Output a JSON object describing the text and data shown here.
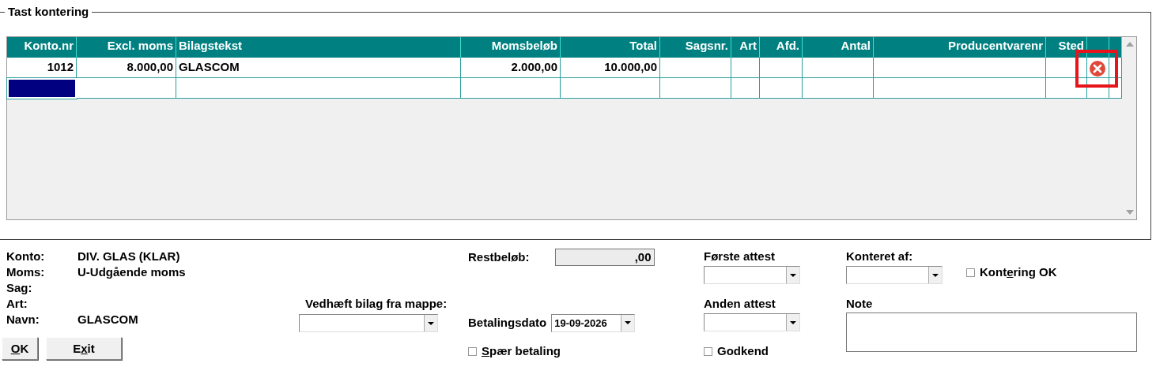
{
  "group": {
    "title": "Tast kontering"
  },
  "table": {
    "columns": [
      {
        "label": "Konto.nr",
        "kind": "number"
      },
      {
        "label": "Excl. moms",
        "kind": "number"
      },
      {
        "label": "Bilagstekst",
        "kind": "text"
      },
      {
        "label": "Momsbeløb",
        "kind": "number"
      },
      {
        "label": "Total",
        "kind": "number"
      },
      {
        "label": "Sagsnr.",
        "kind": "number"
      },
      {
        "label": "Art",
        "kind": "number"
      },
      {
        "label": "Afd.",
        "kind": "number"
      },
      {
        "label": "Antal",
        "kind": "number"
      },
      {
        "label": "Producentvarenr",
        "kind": "number"
      },
      {
        "label": "Sted",
        "kind": "number"
      },
      {
        "kind": "blank"
      },
      {
        "kind": "blank"
      }
    ],
    "rows": [
      {
        "cells": [
          "1012",
          "8.000,00",
          "GLASCOM",
          "2.000,00",
          "10.000,00"
        ],
        "selected": false,
        "deletable": true,
        "highlighted": true
      },
      {
        "selected": true,
        "deletable": false,
        "highlighted": false
      }
    ]
  },
  "info": [
    {
      "label": "Konto:",
      "value": "DIV. GLAS (KLAR)"
    },
    {
      "label": "Moms:",
      "value": "U-Udgående moms"
    },
    {
      "label": "Sag:"
    },
    {
      "label": "Art:"
    },
    {
      "label": "Navn:",
      "value": "GLASCOM"
    }
  ],
  "buttons": [
    {
      "mnemonic": "O",
      "after": "K"
    },
    {
      "before": "E",
      "mnemonic": "x",
      "after": "it"
    }
  ],
  "attach": {
    "label": "Vedhæft bilag fra mappe:"
  },
  "rest": {
    "label": "Restbeløb:",
    "value": ",00"
  },
  "payment_date": {
    "label": "Betalingsdato",
    "value": "19-09-2026"
  },
  "block_payment": {
    "mnemonic": "S",
    "after": "pær betaling",
    "checked": false
  },
  "first_attest": {
    "label": "Første attest"
  },
  "second_attest": {
    "label": "Anden attest"
  },
  "approve": {
    "label": "Godkend",
    "checked": false
  },
  "posted_by": {
    "label": "Konteret af:"
  },
  "posting_ok": {
    "before": "Kont",
    "mnemonic": "e",
    "after": "ring OK",
    "checked": false
  },
  "note": {
    "label": "Note"
  }
}
